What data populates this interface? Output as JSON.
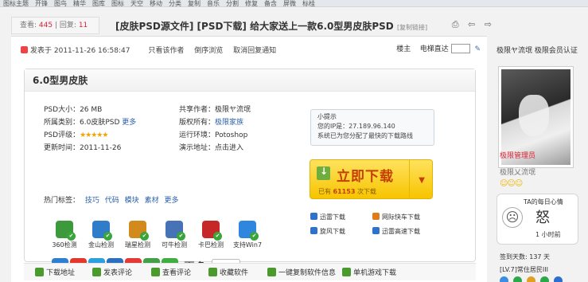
{
  "topnav": [
    "图标主题",
    "开锋",
    "图鸟",
    "精华",
    "图库",
    "图标",
    "天空",
    "移动",
    "分类",
    "复制",
    "音乐",
    "分割",
    "修复",
    "备含",
    "屏微",
    "标桂"
  ],
  "stats": {
    "view_label": "查看:",
    "views": "445",
    "sep": "|",
    "reply_label": "回复:",
    "replies": "11"
  },
  "thread": {
    "title": "[皮肤PSD源文件] [PSD下载] 给大家送上一款6.0型男皮肤PSD",
    "copy_link": "[复制链接]"
  },
  "header_icons": "⎙ ⇦ ⇨",
  "post_meta": {
    "posted": "发表于 2011-11-26 16:58:47",
    "only_author": "只看该作者",
    "reverse": "倒序浏览",
    "cancel_recommend": "取消回复通知"
  },
  "floor": {
    "label": "楼主",
    "jump": "电梯直达"
  },
  "card": {
    "title": "6.0型男皮肤",
    "rows": [
      {
        "l_label": "PSD大小：",
        "l_value": "26 MB",
        "r_label": "共享作者：",
        "r_value": "极限ヤ流氓"
      },
      {
        "l_label": "所属类别：",
        "l_value": "6.0皮肤PSD",
        "l_more": "更多",
        "r_label": "版权所有：",
        "r_value": "极限家族"
      },
      {
        "l_label": "PSD评级：",
        "l_stars": "★★★★★",
        "r_label": "运行环境：",
        "r_value": "Potoshop"
      },
      {
        "l_label": "更新时间：",
        "l_value": "2011-11-26",
        "r_label": "演示地址：",
        "r_value": "点击进入"
      }
    ],
    "tags_label": "热门标签：",
    "tags": [
      "技巧",
      "代码",
      "模块",
      "素材",
      "更多"
    ],
    "checks": [
      {
        "label": "360检测",
        "color": "#3c9a3c"
      },
      {
        "label": "金山检测",
        "color": "#2f7cc9"
      },
      {
        "label": "瑞星检测",
        "color": "#d28a1c"
      },
      {
        "label": "可牛检测",
        "color": "#4673b5"
      },
      {
        "label": "卡巴检测",
        "color": "#c62828"
      },
      {
        "label": "支持Win7",
        "color": "#2e86de"
      }
    ],
    "share": [
      {
        "glyph": "★",
        "color": "#2d7fd2"
      },
      {
        "glyph": "◎",
        "color": "#e2372a"
      },
      {
        "glyph": "P",
        "color": "#2aa0dc"
      },
      {
        "glyph": "⌂",
        "color": "#2c6fbf"
      },
      {
        "glyph": "☆",
        "color": "#e53935"
      },
      {
        "glyph": "♣",
        "color": "#43a047"
      },
      {
        "glyph": "+",
        "color": "#3fae3f"
      }
    ],
    "share_more": "更多",
    "share_count": "3"
  },
  "tip": {
    "title": "小提示",
    "ip_line": "您的IP是：27.189.96.140",
    "line2": "系统已为您分配了最快的下载路线"
  },
  "download": {
    "label": "立即下载",
    "count_prefix": "已有",
    "count": "61153",
    "count_suffix": "次下载",
    "arrow": "▼"
  },
  "mirrors": [
    {
      "label": "迅雷下载",
      "color": "#2e73c9"
    },
    {
      "label": "网际快车下载",
      "color": "#e07a1a"
    },
    {
      "label": "旋风下载",
      "color": "#2e73c9"
    },
    {
      "label": "迅雷高速下载",
      "color": "#2e73c9"
    }
  ],
  "toolbar": [
    {
      "label": "下载地址",
      "color": "#4a9a2e"
    },
    {
      "label": "发表评论",
      "color": "#4a9a2e"
    },
    {
      "label": "查看评论",
      "color": "#4a9a2e"
    },
    {
      "label": "收藏软件",
      "color": "#4a9a2e"
    },
    {
      "label": "一键复制软件信息",
      "color": "#4a9a2e"
    },
    {
      "label": "单机游戏下载",
      "color": "#4a9a2e"
    }
  ],
  "side": {
    "name": "极限ヤ流氓",
    "member": "极限会员认证",
    "role": "极限管理员",
    "username": "极限乂流氓",
    "smileys": "☺☺☺",
    "mood_title": "TA的每日心情",
    "mood_word": "怒",
    "mood_time": "1 小时前",
    "checkin": "签到天数: 137 天",
    "level": "[LV.7]常住居民III",
    "medal_colors": [
      "#3a8de0",
      "#2ba84a",
      "#e0a020",
      "#2ba84a",
      "#2b6fd0"
    ]
  }
}
